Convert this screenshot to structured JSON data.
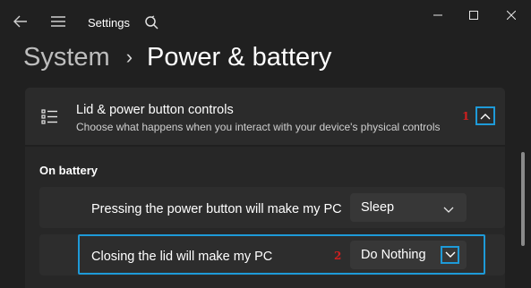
{
  "window": {
    "app_title": "Settings",
    "controls": {
      "minimize": "minimize",
      "maximize": "maximize",
      "close": "close"
    }
  },
  "breadcrumb": {
    "parent": "System",
    "separator": "›",
    "current": "Power & battery"
  },
  "card": {
    "title": "Lid & power button controls",
    "description": "Choose what happens when you interact with your device's physical controls",
    "icon": "list-icon",
    "expanded": true
  },
  "section": {
    "label": "On battery"
  },
  "rows": [
    {
      "label": "Pressing the power button will make my PC",
      "value": "Sleep"
    },
    {
      "label": "Closing the lid will make my PC",
      "value": "Do Nothing"
    }
  ],
  "annotations": {
    "step_1": "1",
    "step_2": "2",
    "highlight_color": "#1e9ad8",
    "number_color": "#d01f1f"
  },
  "theme": {
    "background": "#202020",
    "card": "#2b2b2b"
  }
}
